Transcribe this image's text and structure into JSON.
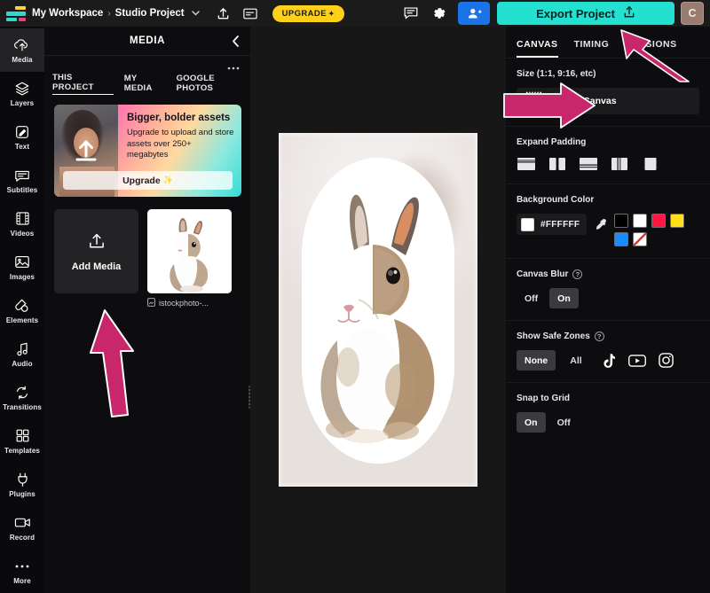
{
  "topbar": {
    "logo_name": "app-logo",
    "workspace": "My Workspace",
    "separator": "›",
    "project": "Studio Project",
    "project_chevron": "⌄",
    "upgrade_label": "UPGRADE",
    "upgrade_sparkle": "✦",
    "share_icon": "add-person-icon",
    "comment_icon": "comment-icon",
    "settings_icon": "gear-icon",
    "upload_icon": "upload-icon",
    "captions_icon": "captions-icon",
    "export_label": "Export Project",
    "export_icon": "export-share-icon",
    "avatar_initial": "C",
    "colors": {
      "upgrade_bg": "#FFD01A",
      "export_bg": "#24E0D0",
      "share_bg": "#1A73E8",
      "avatar_bg": "#9A7D70"
    }
  },
  "rail": {
    "items": [
      {
        "label": "Media",
        "icon": "media-upload-icon",
        "active": true
      },
      {
        "label": "Layers",
        "icon": "layers-icon",
        "active": false
      },
      {
        "label": "Text",
        "icon": "text-edit-icon",
        "active": false
      },
      {
        "label": "Subtitles",
        "icon": "subtitles-icon",
        "active": false
      },
      {
        "label": "Videos",
        "icon": "video-film-icon",
        "active": false
      },
      {
        "label": "Images",
        "icon": "image-icon",
        "active": false
      },
      {
        "label": "Elements",
        "icon": "elements-shape-icon",
        "active": false
      },
      {
        "label": "Audio",
        "icon": "audio-note-icon",
        "active": false
      },
      {
        "label": "Transitions",
        "icon": "transitions-icon",
        "active": false
      },
      {
        "label": "Templates",
        "icon": "templates-grid-icon",
        "active": false
      },
      {
        "label": "Plugins",
        "icon": "plugin-plug-icon",
        "active": false
      },
      {
        "label": "Record",
        "icon": "record-camera-icon",
        "active": false
      },
      {
        "label": "More",
        "icon": "more-dots-icon",
        "active": false
      }
    ]
  },
  "media_panel": {
    "title": "MEDIA",
    "collapse_icon": "chevron-left-icon",
    "overflow_icon": "more-horizontal-icon",
    "tabs": [
      {
        "label": "THIS PROJECT",
        "active": true
      },
      {
        "label": "MY MEDIA",
        "active": false
      },
      {
        "label": "GOOGLE PHOTOS",
        "active": false
      }
    ],
    "promo": {
      "heading": "Bigger, bolder assets",
      "body": "Upgrade to upload and store assets over 250+ megabytes",
      "cta": "Upgrade",
      "cta_sparkle": "✨",
      "image_icon": "upload-arrow-icon"
    },
    "add_media": {
      "label": "Add Media",
      "icon": "upload-tray-icon"
    },
    "assets": [
      {
        "name": "istockphoto-...",
        "icon": "image-file-icon",
        "thumb": "rabbit-photo"
      }
    ]
  },
  "stage": {
    "canvas_name": "video-canvas",
    "artwork": "rabbit-on-white-background",
    "background_color": "#FFFFFF"
  },
  "right_panel": {
    "tabs": [
      {
        "label": "CANVAS",
        "active": true
      },
      {
        "label": "TIMING",
        "active": false
      },
      {
        "label": "VERSIONS",
        "active": false
      }
    ],
    "size": {
      "heading": "Size (1:1, 9:16, etc)",
      "resize_label": "Resize Canvas",
      "resize_icon": "resize-canvas-icon"
    },
    "expand_padding": {
      "heading": "Expand Padding",
      "options": [
        "padding-top-bottom-icon",
        "padding-left-right-icon",
        "padding-bottom-icon",
        "padding-left-icon",
        "padding-none-icon"
      ]
    },
    "background_color": {
      "heading": "Background Color",
      "hex_value": "#FFFFFF",
      "eyedropper_icon": "eyedropper-icon",
      "swatches": [
        "#000000",
        "#FFFFFF",
        "#FF1744",
        "#FFE01A",
        "#1A8CFF",
        "none"
      ]
    },
    "canvas_blur": {
      "heading": "Canvas Blur",
      "help_icon": "help-icon",
      "options": [
        "Off",
        "On"
      ],
      "selected": "On"
    },
    "safe_zones": {
      "heading": "Show Safe Zones",
      "help_icon": "help-icon",
      "options": [
        "None",
        "All"
      ],
      "selected": "None",
      "platform_icons": [
        "tiktok-icon",
        "youtube-icon",
        "instagram-icon"
      ]
    },
    "snap_to_grid": {
      "heading": "Snap to Grid",
      "options": [
        "On",
        "Off"
      ],
      "selected": "On"
    }
  },
  "annotations": {
    "arrow_color": "#C9276B",
    "arrows": [
      {
        "name": "arrow-to-versions-tab"
      },
      {
        "name": "arrow-to-resize-canvas"
      },
      {
        "name": "arrow-to-add-media"
      },
      {
        "name": "arrow-to-export-project"
      }
    ]
  }
}
